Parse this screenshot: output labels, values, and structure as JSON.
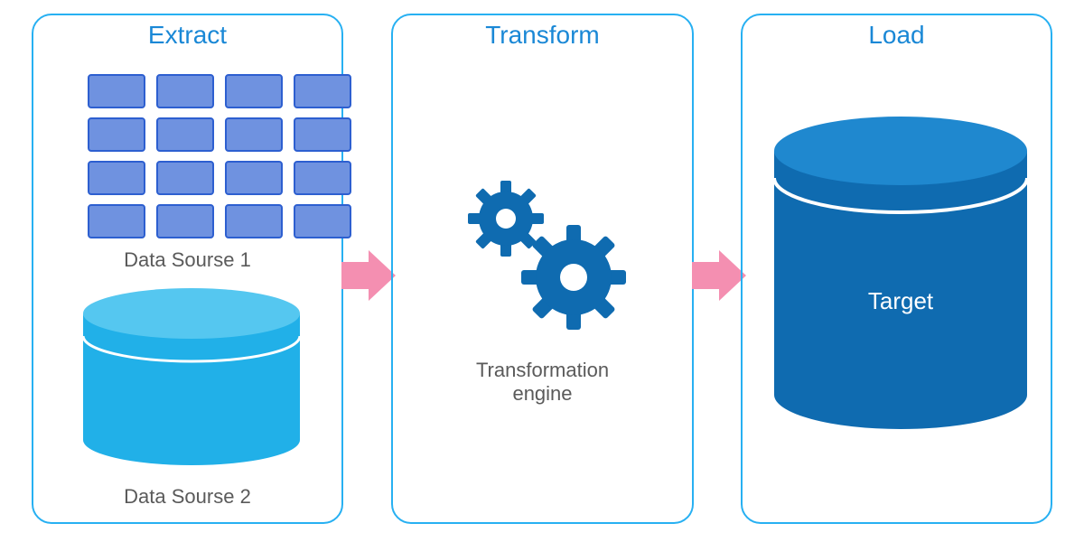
{
  "stages": {
    "extract": {
      "title": "Extract",
      "source1_label": "Data Sourse 1",
      "source2_label": "Data Sourse 2"
    },
    "transform": {
      "title": "Transform",
      "engine_label": "Transformation\nengine"
    },
    "load": {
      "title": "Load",
      "target_label": "Target"
    }
  },
  "colors": {
    "box_border": "#27b0f2",
    "title": "#1a88d6",
    "cell_fill": "#6f92e0",
    "cell_border": "#2d5fd0",
    "cyl_light": "#21b0e8",
    "cyl_dark": "#0f6bb0",
    "gear": "#0f6bb0",
    "arrow": "#f48fb1"
  }
}
